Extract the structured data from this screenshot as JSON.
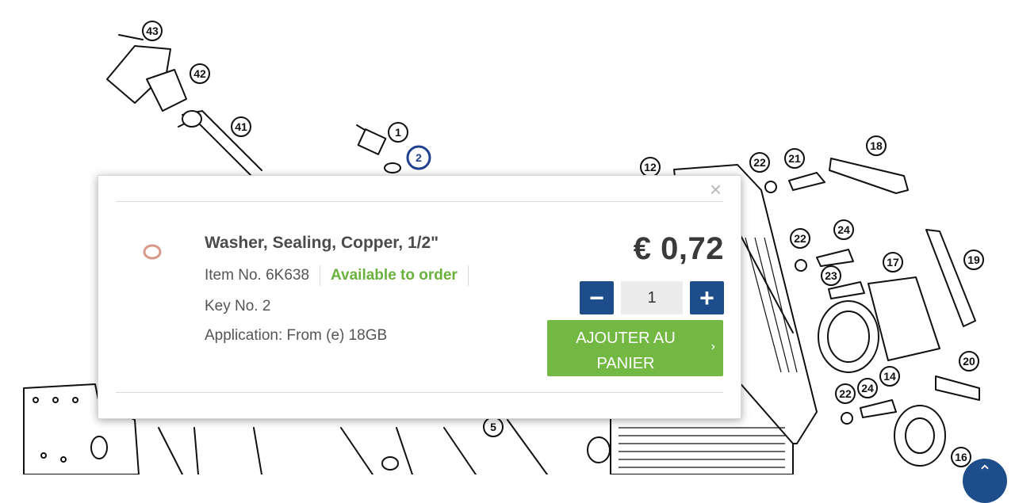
{
  "diagram": {
    "callouts": [
      "43",
      "42",
      "41",
      "1",
      "2",
      "12",
      "22",
      "21",
      "18",
      "22",
      "24",
      "17",
      "19",
      "23",
      "14",
      "20",
      "22",
      "24",
      "16",
      "5"
    ]
  },
  "popup": {
    "close_label": "×",
    "product": {
      "title": "Washer, Sealing, Copper, 1/2\"",
      "item_no": "Item No. 6K638",
      "availability": "Available to order",
      "key_no": "Key No. 2",
      "application": "Application: From (e) 18GB"
    },
    "price": "€ 0,72",
    "quantity": {
      "minus_label": "−",
      "value": "1",
      "plus_label": "+"
    },
    "add_to_cart_label": "AJOUTER AU PANIER",
    "add_to_cart_chevron": "›"
  },
  "colors": {
    "primary_blue": "#1e4d8c",
    "cta_green": "#72b843",
    "available_green": "#6ab23d",
    "copper": "#d9998a"
  },
  "scroll_top_icon": "chevron-up-icon"
}
